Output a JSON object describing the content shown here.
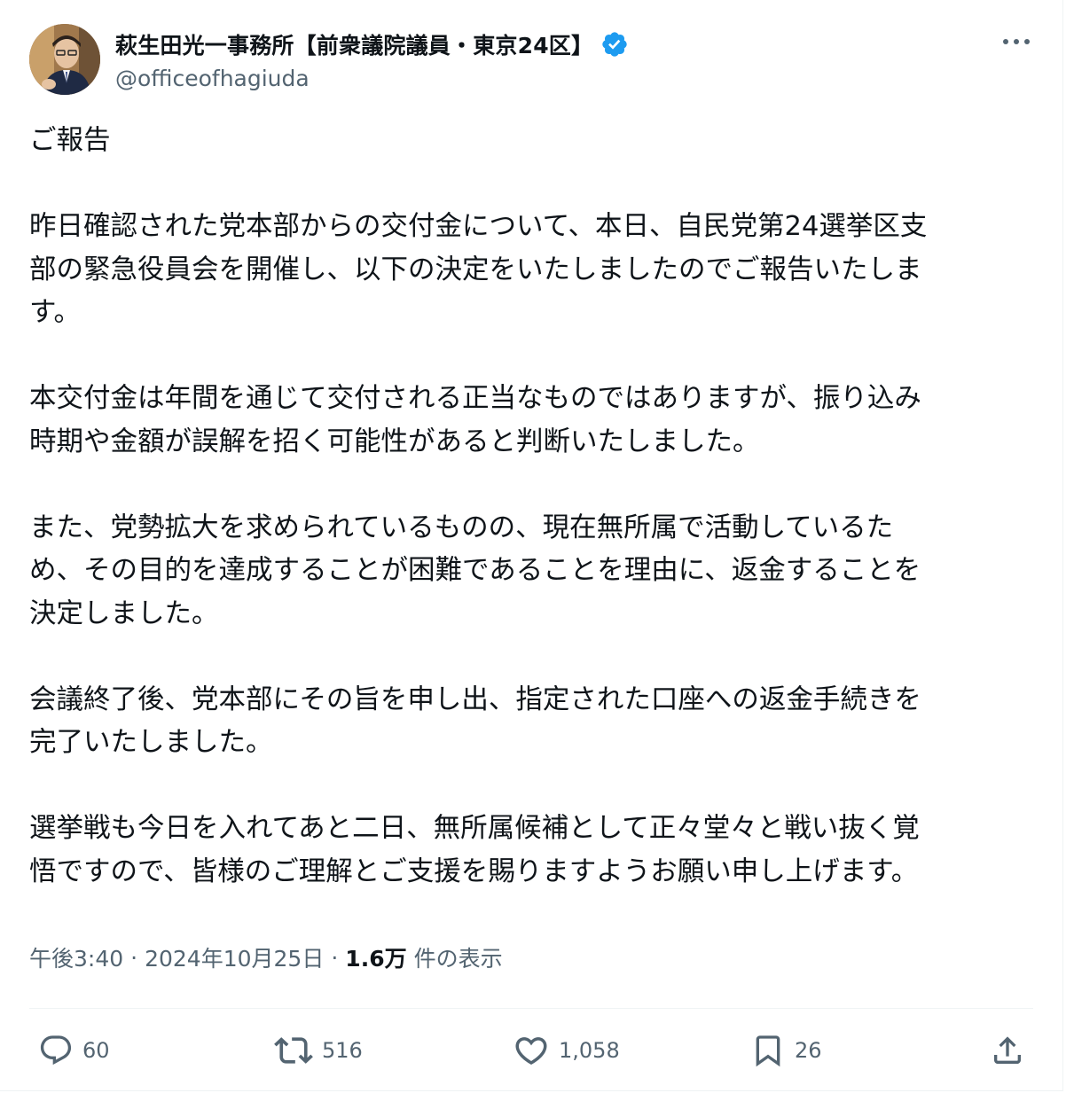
{
  "author": {
    "display_name": "萩生田光一事務所【前衆議院議員・東京24区】",
    "handle": "@officeofhagiuda",
    "verified_color": "#1d9bf0"
  },
  "tweet": {
    "paragraphs": [
      "ご報告",
      "昨日確認された党本部からの交付金について、本日、自民党第24選挙区支\n部の緊急役員会を開催し、以下の決定をいたしましたのでご報告いたしま\nす。",
      "本交付金は年間を通じて交付される正当なものではありますが、振り込み\n時期や金額が誤解を招く可能性があると判断いたしました。",
      "また、党勢拡大を求められているものの、現在無所属で活動しているた\nめ、その目的を達成することが困難であることを理由に、返金することを\n決定しました。",
      "会議終了後、党本部にその旨を申し出、指定された口座への返金手続きを\n完了いたしました。",
      "選挙戦も今日を入れてあと二日、無所属候補として正々堂々と戦い抜く覚\n悟ですので、皆様のご理解とご支援を賜りますようお願い申し上げます。"
    ]
  },
  "meta": {
    "time": "午後3:40",
    "dot1": "·",
    "date": "2024年10月25日",
    "dot2": "·",
    "views_count": "1.6万",
    "views_label": "件の表示"
  },
  "actions": {
    "reply_count": "60",
    "retweet_count": "516",
    "like_count": "1,058",
    "bookmark_count": "26"
  },
  "icons": {
    "more": "more-horizontal-icon",
    "reply": "reply-icon",
    "retweet": "retweet-icon",
    "like": "heart-icon",
    "bookmark": "bookmark-icon",
    "share": "share-icon"
  }
}
